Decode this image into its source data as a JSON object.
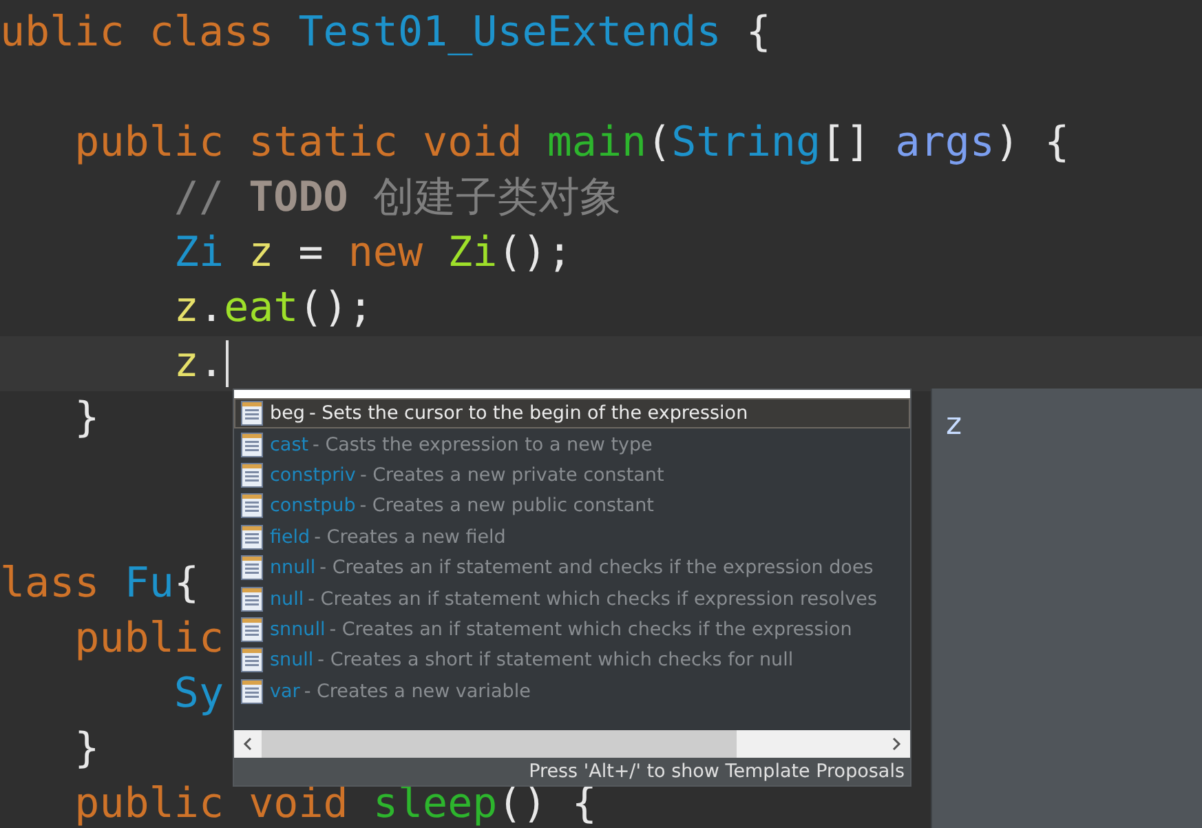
{
  "code_lines": [
    {
      "kind": "code",
      "tokens": [
        {
          "text": "ublic class ",
          "kind": "keyword"
        },
        {
          "text": "Test01_UseExtends",
          "kind": "type"
        },
        {
          "text": " {",
          "kind": "punct"
        }
      ]
    },
    {
      "kind": "blank"
    },
    {
      "kind": "code",
      "tokens": [
        {
          "text": "   public static void ",
          "kind": "keyword"
        },
        {
          "text": "main",
          "kind": "method"
        },
        {
          "text": "(",
          "kind": "punct"
        },
        {
          "text": "String",
          "kind": "type"
        },
        {
          "text": "[] ",
          "kind": "punct"
        },
        {
          "text": "args",
          "kind": "param"
        },
        {
          "text": ") {",
          "kind": "punct"
        }
      ]
    },
    {
      "kind": "code",
      "tokens": [
        {
          "text": "       // ",
          "kind": "comment"
        },
        {
          "text": "TODO",
          "kind": "todo"
        },
        {
          "text": " 创建子类对象",
          "kind": "comment"
        }
      ]
    },
    {
      "kind": "code",
      "tokens": [
        {
          "text": "       Zi",
          "kind": "type"
        },
        {
          "text": " z",
          "kind": "var"
        },
        {
          "text": " = ",
          "kind": "punct"
        },
        {
          "text": "new ",
          "kind": "keyword"
        },
        {
          "text": "Zi",
          "kind": "call"
        },
        {
          "text": "();",
          "kind": "punct"
        }
      ]
    },
    {
      "kind": "code",
      "tokens": [
        {
          "text": "       z",
          "kind": "var"
        },
        {
          "text": ".",
          "kind": "punct"
        },
        {
          "text": "eat",
          "kind": "call"
        },
        {
          "text": "();",
          "kind": "punct"
        }
      ]
    },
    {
      "kind": "cursor_line",
      "tokens": [
        {
          "text": "       z",
          "kind": "var"
        },
        {
          "text": ".",
          "kind": "punct"
        }
      ]
    },
    {
      "kind": "code",
      "tokens": [
        {
          "text": "   }",
          "kind": "punct"
        }
      ]
    },
    {
      "kind": "blank"
    },
    {
      "kind": "blank"
    },
    {
      "kind": "code",
      "tokens": [
        {
          "text": "lass ",
          "kind": "keyword"
        },
        {
          "text": "Fu",
          "kind": "type"
        },
        {
          "text": "{",
          "kind": "punct"
        }
      ]
    },
    {
      "kind": "code",
      "tokens": [
        {
          "text": "   public",
          "kind": "keyword"
        }
      ]
    },
    {
      "kind": "code",
      "tokens": [
        {
          "text": "       Sy",
          "kind": "type"
        }
      ]
    },
    {
      "kind": "code",
      "tokens": [
        {
          "text": "   }",
          "kind": "punct"
        }
      ]
    },
    {
      "kind": "code",
      "tokens": [
        {
          "text": "   public void ",
          "kind": "keyword"
        },
        {
          "text": "sleep",
          "kind": "method"
        },
        {
          "text": "() {",
          "kind": "punct"
        }
      ]
    }
  ],
  "proposals": [
    {
      "name": "beg",
      "description": "- Sets the cursor to the begin of the expression",
      "selected": true
    },
    {
      "name": "cast",
      "description": "- Casts the expression to a new type",
      "selected": false
    },
    {
      "name": "constpriv",
      "description": "- Creates a new private constant",
      "selected": false
    },
    {
      "name": "constpub",
      "description": "- Creates a new public constant",
      "selected": false
    },
    {
      "name": "field",
      "description": "- Creates a new field",
      "selected": false
    },
    {
      "name": "nnull",
      "description": "- Creates an if statement and checks if the expression does",
      "selected": false
    },
    {
      "name": "null",
      "description": "- Creates an if statement which checks if expression resolves",
      "selected": false
    },
    {
      "name": "snnull",
      "description": "- Creates an if statement which checks if the expression",
      "selected": false
    },
    {
      "name": "snull",
      "description": "- Creates a short if statement which checks for null",
      "selected": false
    },
    {
      "name": "var",
      "description": "- Creates a new variable",
      "selected": false
    }
  ],
  "hint": "Press 'Alt+/' to show Template Proposals",
  "info_panel": {
    "text": "z"
  }
}
